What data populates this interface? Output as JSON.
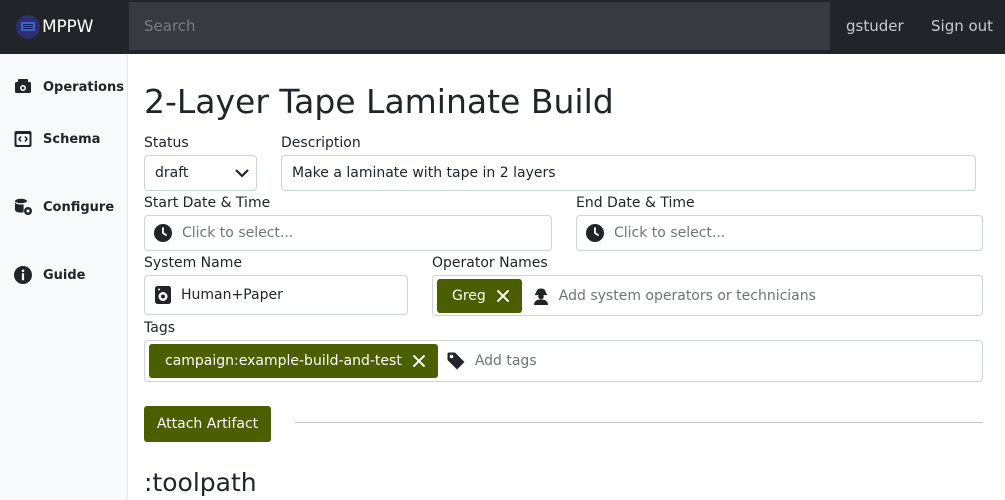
{
  "navbar": {
    "brand": "MPPW",
    "search_placeholder": "Search",
    "user": "gstuder",
    "signout": "Sign out"
  },
  "sidebar": {
    "items": [
      {
        "label": "Operations",
        "icon": "operations-icon"
      },
      {
        "label": "Schema",
        "icon": "schema-icon"
      },
      {
        "label": "Configure",
        "icon": "configure-icon"
      },
      {
        "label": "Guide",
        "icon": "info-icon"
      }
    ]
  },
  "page": {
    "title": "2-Layer Tape Laminate Build"
  },
  "form": {
    "status": {
      "label": "Status",
      "value": "draft"
    },
    "description": {
      "label": "Description",
      "value": "Make a laminate with tape in 2 layers"
    },
    "start": {
      "label": "Start Date & Time",
      "placeholder": "Click to select..."
    },
    "end": {
      "label": "End Date & Time",
      "placeholder": "Click to select..."
    },
    "system": {
      "label": "System Name",
      "value": "Human+Paper"
    },
    "operators": {
      "label": "Operator Names",
      "chips": [
        "Greg"
      ],
      "placeholder": "Add system operators or technicians"
    },
    "tags": {
      "label": "Tags",
      "chips": [
        "campaign:example-build-and-test"
      ],
      "placeholder": "Add tags"
    }
  },
  "actions": {
    "attach_artifact": "Attach Artifact"
  },
  "sections": {
    "toolpath": ":toolpath"
  },
  "colors": {
    "navbar": "#212529",
    "search_bg": "#373a3e",
    "accent": "#4b5e00",
    "sidebar_bg": "#f8f9fa"
  }
}
